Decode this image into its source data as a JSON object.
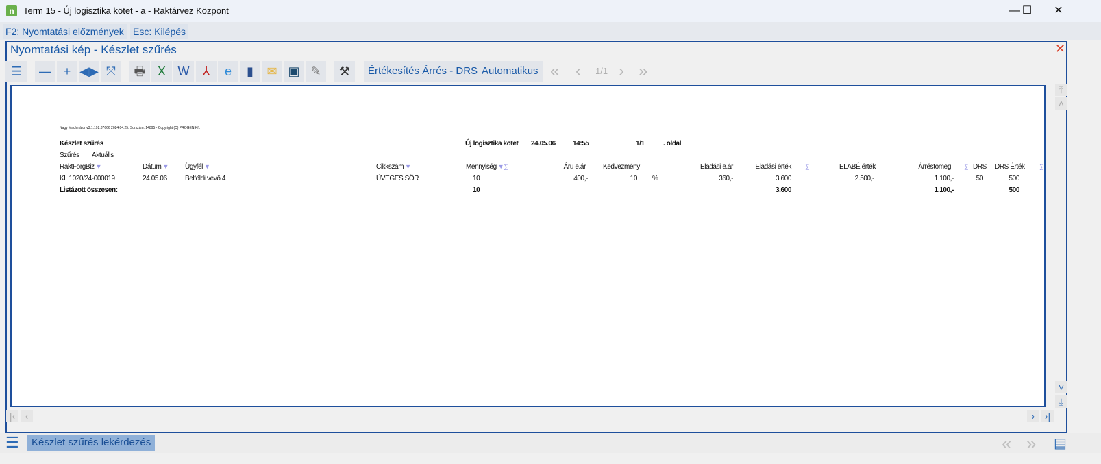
{
  "window": {
    "title": "Term 15 - Új logisztika kötet - a - Raktárvez Központ",
    "minimize": "—",
    "maximize": "☐",
    "close": "✕"
  },
  "menubar": {
    "history": "F2: Nyomtatási előzmények",
    "exit": "Esc: Kilépés"
  },
  "inner": {
    "title": "Nyomtatási kép - Készlet szűrés",
    "close": "✕"
  },
  "toolbar": {
    "report_label": "Értékesítés Árrés - DRS",
    "mode_label": "Automatikus",
    "page": "1/1"
  },
  "report": {
    "copyright": "Nagy Machinátor v3.1.192.87666 2024.04.25. Sorszám: 14895 - Copyright (C) PROGEN Kft.",
    "title": "Készlet szűrés",
    "volume": "Új logisztika kötet",
    "date": "24.05.06",
    "time": "14:55",
    "page": "1/1",
    "page_suffix": ". oldal",
    "filter_label": "Szűrés",
    "filter_value": "Aktuális",
    "columns": {
      "c0": "RaktForgBiz",
      "c1": "Dátum",
      "c2": "Ügyfél",
      "c3": "Cikkszám",
      "c4": "Mennyiség",
      "c5": "Áru e.ár",
      "c6": "Kedvezmény",
      "c7": "Eladási e.ár",
      "c8": "Eladási érték",
      "c9": "ELABÉ érték",
      "c10": "Árréstömeg",
      "c11": "DRS",
      "c12": "DRS Érték"
    },
    "row": {
      "c0": "KL 1020/24-000019",
      "c1": "24.05.06",
      "c2": "Belföldi vevő 4",
      "c3": "ÜVEGES SÖR",
      "c4": "10",
      "c5": "400,-",
      "c6": "10",
      "c6u": "%",
      "c7": "360,-",
      "c8": "3.600",
      "c9": "2.500,-",
      "c10": "1.100,-",
      "c11": "50",
      "c12": "500"
    },
    "total": {
      "label": "Listázott összesen:",
      "c4": "10",
      "c8": "3.600",
      "c10": "1.100,-",
      "c12": "500"
    }
  },
  "footer": {
    "tab": "Készlet szűrés lekérdezés"
  }
}
